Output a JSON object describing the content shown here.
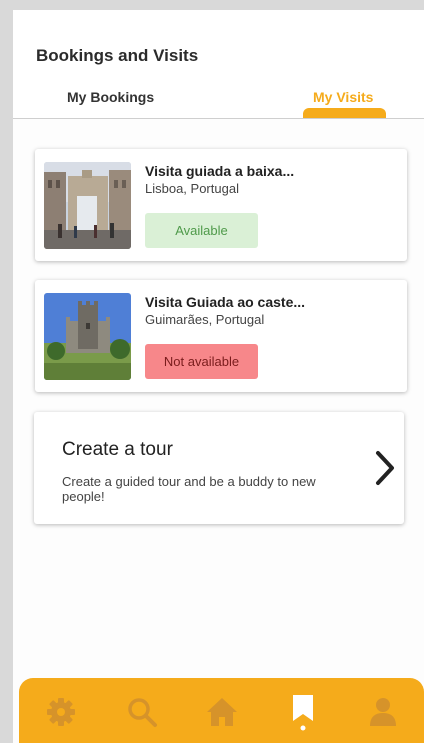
{
  "header": {
    "title": "Bookings and Visits"
  },
  "tabs": [
    {
      "label": "My Bookings",
      "active": false
    },
    {
      "label": "My Visits",
      "active": true
    }
  ],
  "visits": [
    {
      "title": "Visita guiada a baixa...",
      "location": "Lisboa, Portugal",
      "status": "Available"
    },
    {
      "title": "Visita Guiada ao caste...",
      "location": "Guimarães, Portugal",
      "status": "Not available"
    }
  ],
  "create_tour": {
    "title": "Create a tour",
    "description": "Create a guided tour and be a buddy to new people!"
  },
  "bottom_nav": {
    "active": "bookmark",
    "items": [
      "settings-icon",
      "search-icon",
      "home-icon",
      "bookmark-icon",
      "profile-icon"
    ]
  },
  "colors": {
    "accent": "#f5ab1b",
    "accent_icon": "#d6932a",
    "available_bg": "#daf0d6",
    "available_text": "#4f9a4a",
    "unavailable_bg": "#f7878a"
  }
}
